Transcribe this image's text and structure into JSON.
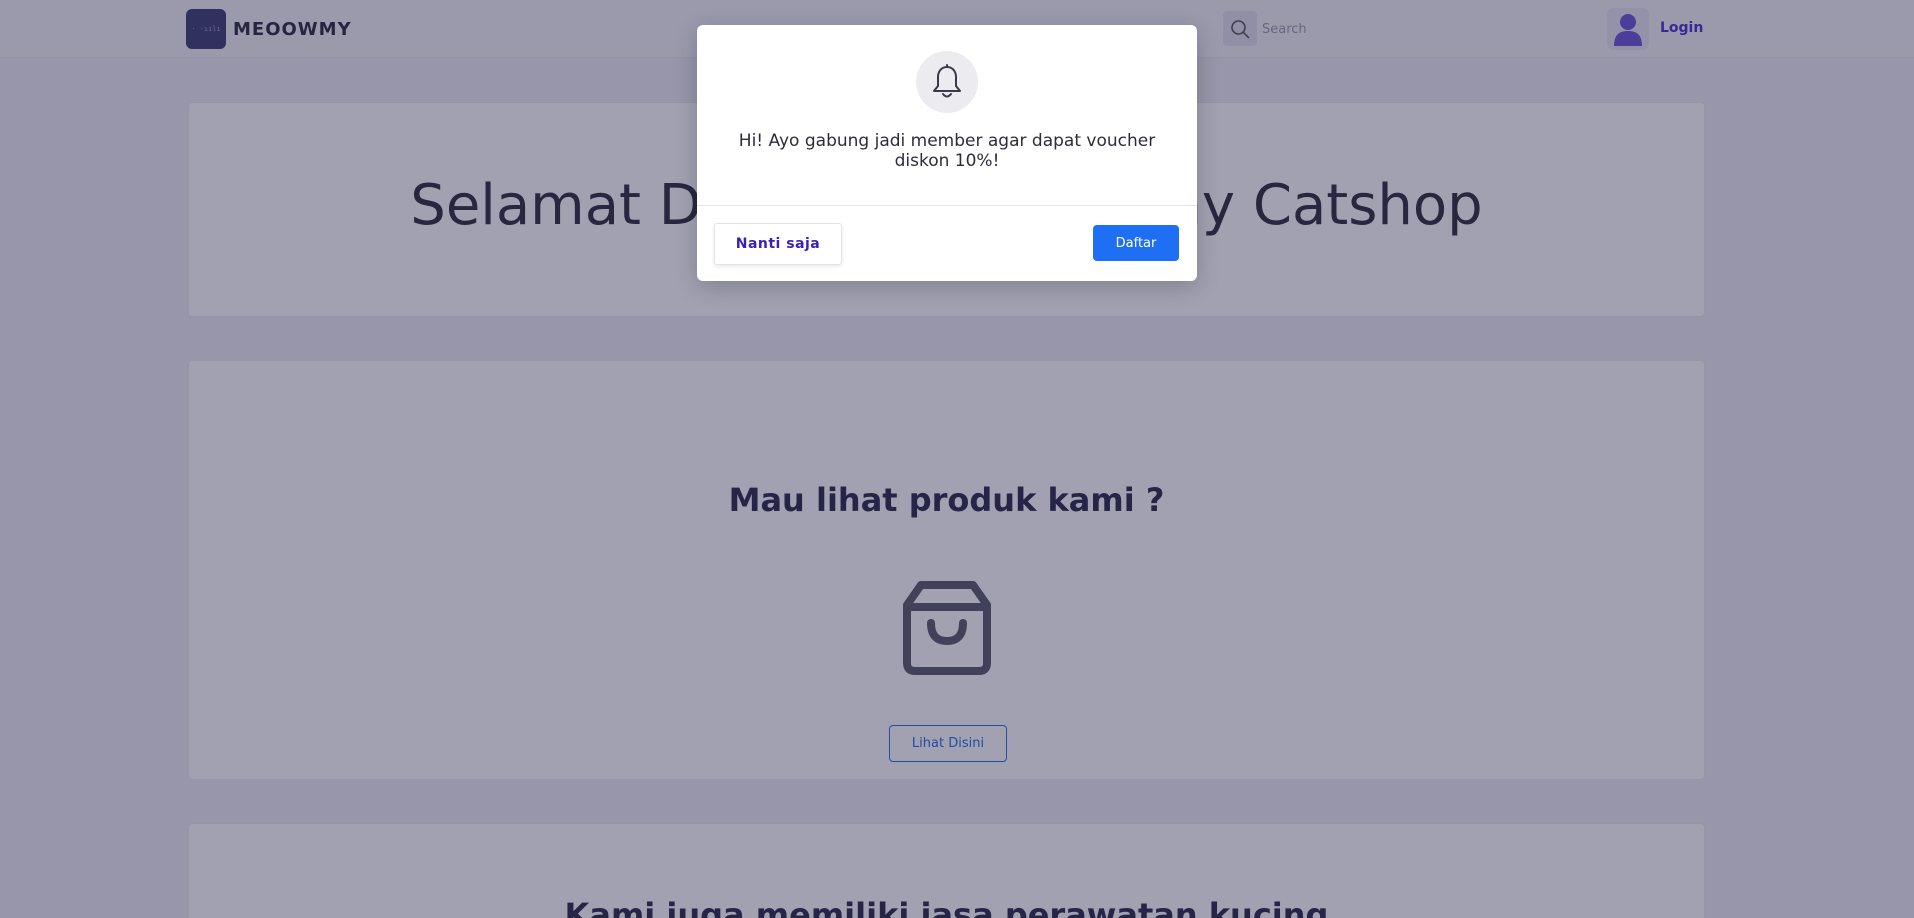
{
  "navbar": {
    "brand_logo_text": "· ·ıılı",
    "brand_name": "MEOOWMY",
    "search_placeholder": "Search",
    "login_label": "Login"
  },
  "hero": {
    "title": "Selamat Datang di Meoowmy Catshop"
  },
  "products": {
    "title": "Mau lihat produk kami ?",
    "button_label": "Lihat Disini"
  },
  "services": {
    "title": "Kami juga memiliki jasa perawatan kucing"
  },
  "modal": {
    "message": "Hi! Ayo gabung jadi member agar dapat voucher diskon 10%!",
    "later_label": "Nanti saja",
    "register_label": "Daftar"
  },
  "colors": {
    "accent": "#1f6ff5",
    "login_link": "#4a2fd0",
    "overlay": "#221e48"
  },
  "icons": {
    "search": "search-icon",
    "user": "user-icon",
    "bell": "bell-icon",
    "bag": "shopping-bag-icon"
  }
}
